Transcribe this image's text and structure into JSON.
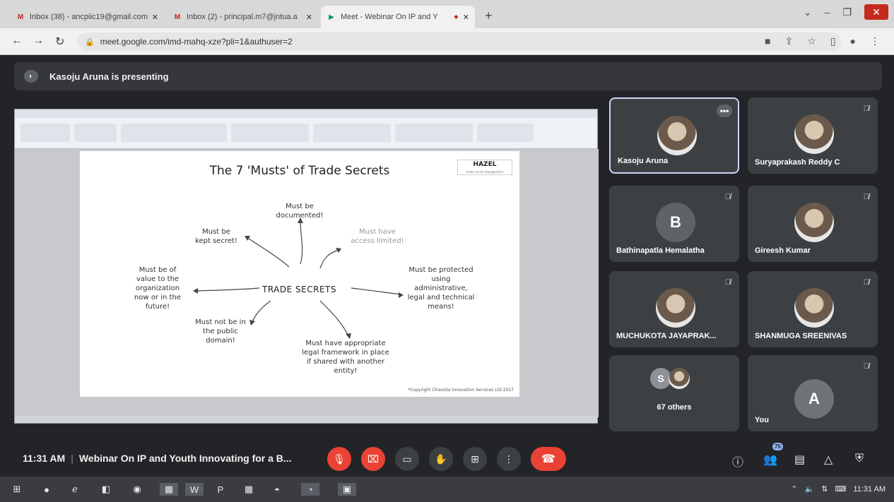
{
  "browser": {
    "tabs": [
      {
        "favicon": "M",
        "title": "Inbox (38) - ancpiic19@gmail.com",
        "active": false
      },
      {
        "favicon": "M",
        "title": "Inbox (2) - principal.m7@jntua.a",
        "active": false
      },
      {
        "favicon": "meet-icon",
        "title": "Meet - Webinar On IP and Y",
        "active": true
      }
    ],
    "new_tab": "+",
    "url": "meet.google.com/imd-mahq-xze?pli=1&authuser=2"
  },
  "meet": {
    "presenting_text": "Kasoju Aruna is presenting",
    "slide": {
      "title": "The 7 'Musts' of Trade Secrets",
      "logo_title": "HAZEL",
      "logo_sub": "trade secret management",
      "center": "TRADE SECRETS",
      "notes": [
        "Must be\ndocumented!",
        "Must be\nkept secret!",
        "Must have\naccess limited!",
        "Must be of\nvalue to the\norganization\nnow or in the\nfuture!",
        "Must be protected\nusing\nadministrative,\nlegal and technical\nmeans!",
        "Must not be in\nthe public\ndomain!",
        "Must have appropriate\nlegal framework in place\nif shared with another\nentity!"
      ],
      "copyright": "*Copyright Chavista Innovation Services Ltd 2017"
    },
    "participants": [
      {
        "name": "Kasoju Aruna",
        "avatar": "photo",
        "muted": false,
        "speaking": true
      },
      {
        "name": "Suryaprakash Reddy C",
        "avatar": "photo",
        "muted": true
      },
      {
        "name": "Bathinapatla Hemalatha",
        "avatar": "B",
        "muted": true
      },
      {
        "name": "Gireesh Kumar",
        "avatar": "photo",
        "muted": true
      },
      {
        "name": "MUCHUKOTA JAYAPRAK...",
        "avatar": "photo",
        "muted": true
      },
      {
        "name": "SHANMUGA SREENIVAS",
        "avatar": "photo",
        "muted": true
      },
      {
        "name": "67 others",
        "avatar": "S"
      },
      {
        "name": "You",
        "avatar": "A",
        "muted": true
      }
    ],
    "time": "11:31 AM",
    "meeting_title": "Webinar On IP and Youth Innovating for a B...",
    "people_count": "75",
    "colors": {
      "hangup": "#ea4335",
      "bg": "#202124",
      "tile": "#3c4043"
    }
  },
  "taskbar": {
    "clock": "11:31 AM"
  }
}
